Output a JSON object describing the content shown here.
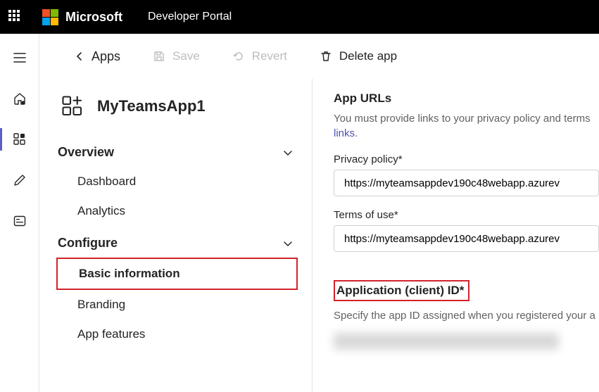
{
  "topbar": {
    "brand": "Microsoft",
    "portal": "Developer Portal"
  },
  "toolbar": {
    "back_label": "Apps",
    "save_label": "Save",
    "revert_label": "Revert",
    "delete_label": "Delete app"
  },
  "app": {
    "name": "MyTeamsApp1"
  },
  "nav": {
    "overview": {
      "title": "Overview",
      "items": [
        "Dashboard",
        "Analytics"
      ]
    },
    "configure": {
      "title": "Configure",
      "items": [
        "Basic information",
        "Branding",
        "App features"
      ]
    }
  },
  "main": {
    "urls": {
      "title": "App URLs",
      "help_prefix": "You must provide links to your privacy policy and terms",
      "links_word": "links",
      "privacy_label": "Privacy policy*",
      "privacy_value": "https://myteamsappdev190c48webapp.azurev",
      "terms_label": "Terms of use*",
      "terms_value": "https://myteamsappdev190c48webapp.azurev"
    },
    "client_id": {
      "title": "Application (client) ID*",
      "help": "Specify the app ID assigned when you registered your a"
    }
  }
}
